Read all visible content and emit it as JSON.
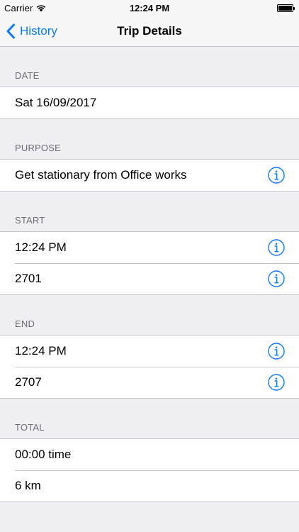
{
  "status_bar": {
    "carrier": "Carrier",
    "time": "12:24 PM"
  },
  "nav": {
    "back_label": "History",
    "title": "Trip Details"
  },
  "sections": {
    "date": {
      "header": "DATE",
      "rows": [
        "Sat 16/09/2017"
      ]
    },
    "purpose": {
      "header": "PURPOSE",
      "rows": [
        "Get stationary from Office works"
      ]
    },
    "start": {
      "header": "START",
      "rows": [
        "12:24 PM",
        "2701"
      ]
    },
    "end": {
      "header": "END",
      "rows": [
        "12:24 PM",
        "2707"
      ]
    },
    "total": {
      "header": "TOTAL",
      "rows": [
        "00:00 time",
        "6 km"
      ]
    }
  },
  "colors": {
    "accent": "#0e7afe",
    "background": "#efeff4",
    "separator": "#c8c7cc",
    "header_text": "#6d6d72"
  },
  "icons": {
    "info": "info-circle-icon",
    "back": "chevron-left-icon",
    "wifi": "wifi-icon",
    "battery": "battery-icon"
  }
}
